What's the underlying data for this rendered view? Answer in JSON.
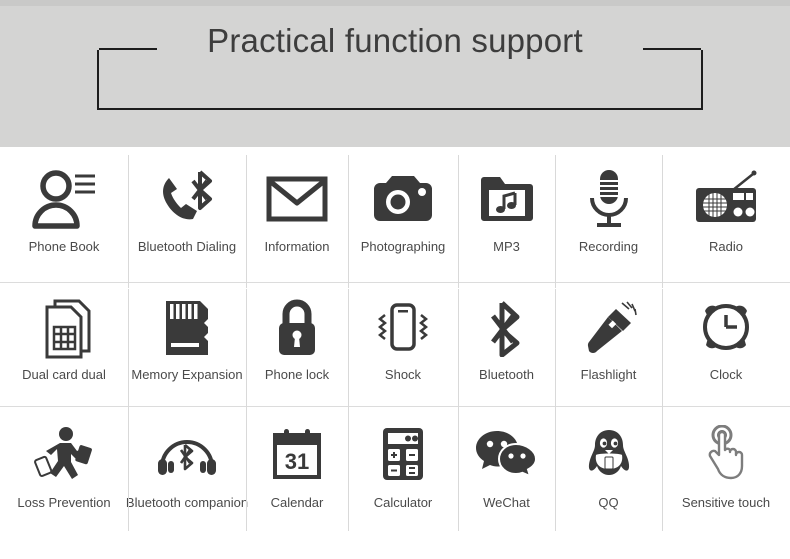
{
  "header": {
    "title": "Practical function support",
    "background_color": "#d4d4d3",
    "border_color": "#1d1d1d",
    "title_color": "#3d3d3d"
  },
  "grid": {
    "divider_color": "#d9d9d9",
    "icon_color": "#3a3a3a",
    "label_color": "#4a4a4a",
    "rows": [
      {
        "items": [
          {
            "label": "Phone Book",
            "icon": "contact-person-list-icon"
          },
          {
            "label": "Bluetooth Dialing",
            "icon": "phone-handset-bluetooth-icon"
          },
          {
            "label": "Information",
            "icon": "envelope-message-icon"
          },
          {
            "label": "Photographing",
            "icon": "camera-icon"
          },
          {
            "label": "MP3",
            "icon": "music-folder-icon"
          },
          {
            "label": "Recording",
            "icon": "microphone-icon"
          },
          {
            "label": "Radio",
            "icon": "radio-icon"
          }
        ]
      },
      {
        "items": [
          {
            "label": "Dual card dual",
            "icon": "dual-sim-card-icon"
          },
          {
            "label": "Memory Expansion",
            "icon": "memory-card-icon"
          },
          {
            "label": "Phone lock",
            "icon": "padlock-icon"
          },
          {
            "label": "Shock",
            "icon": "phone-vibrate-icon"
          },
          {
            "label": "Bluetooth",
            "icon": "bluetooth-icon"
          },
          {
            "label": "Flashlight",
            "icon": "flashlight-icon"
          },
          {
            "label": "Clock",
            "icon": "alarm-clock-icon"
          }
        ]
      },
      {
        "items": [
          {
            "label": "Loss Prevention",
            "icon": "anti-loss-walking-person-icon"
          },
          {
            "label": "Bluetooth companion",
            "icon": "bluetooth-headphones-icon"
          },
          {
            "label": "Calendar",
            "icon": "calendar-31-icon",
            "day": "31"
          },
          {
            "label": "Calculator",
            "icon": "calculator-icon"
          },
          {
            "label": "WeChat",
            "icon": "wechat-bubbles-icon"
          },
          {
            "label": "QQ",
            "icon": "qq-penguin-icon"
          },
          {
            "label": "Sensitive touch",
            "icon": "touch-hand-icon"
          }
        ]
      }
    ]
  }
}
